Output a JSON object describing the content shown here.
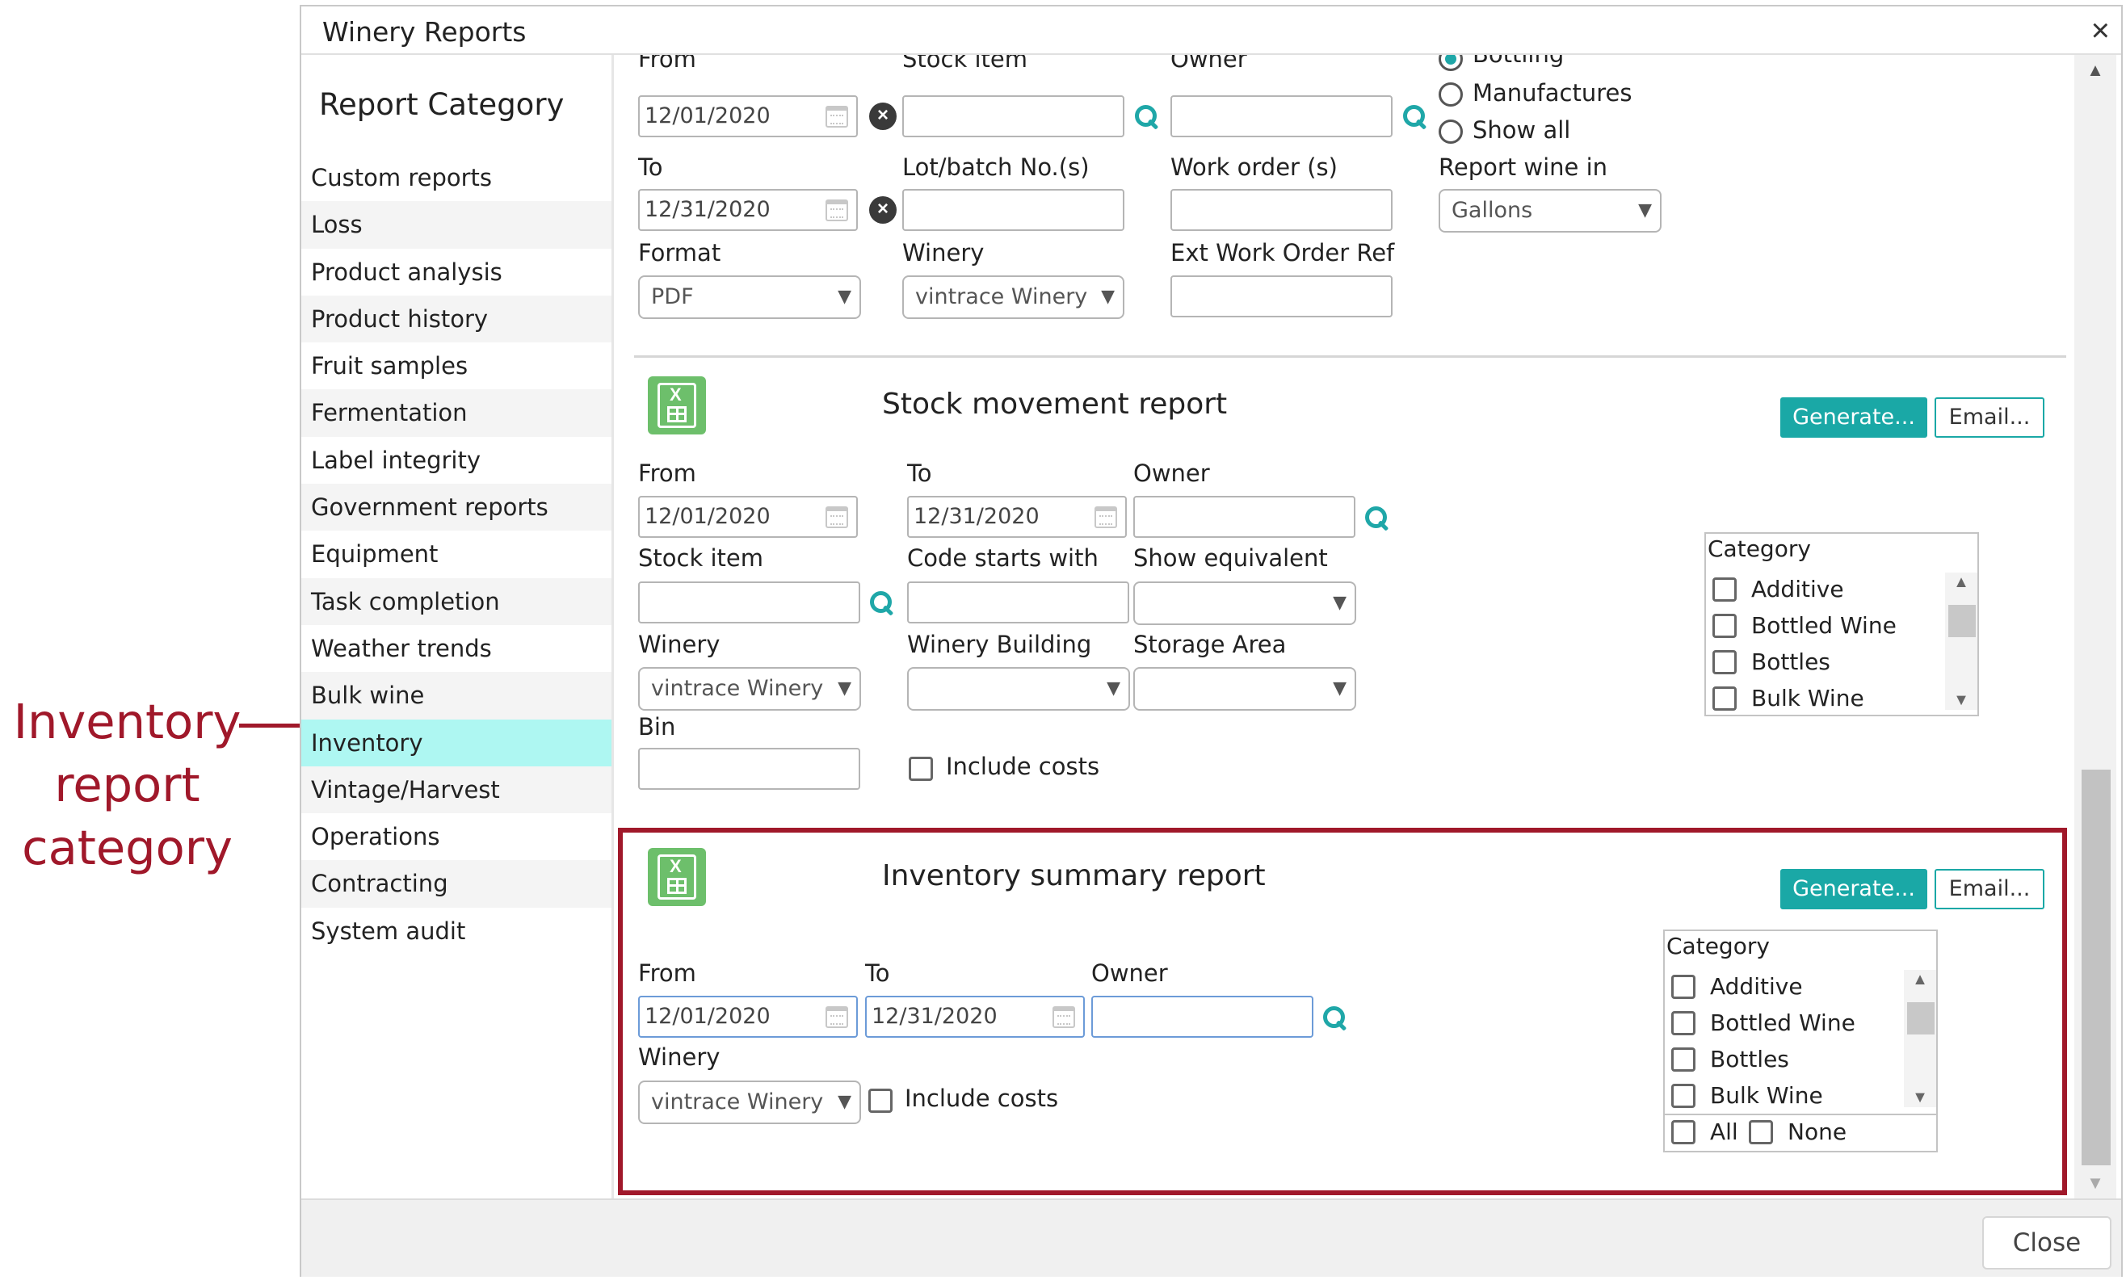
{
  "callout": {
    "line1": "Inventory",
    "line2": "report",
    "line3": "category"
  },
  "window": {
    "title": "Winery Reports",
    "close_icon": "×"
  },
  "sidebar": {
    "heading": "Report Category",
    "items": [
      {
        "label": "Custom reports"
      },
      {
        "label": "Loss"
      },
      {
        "label": "Product analysis"
      },
      {
        "label": "Product history"
      },
      {
        "label": "Fruit samples"
      },
      {
        "label": "Fermentation"
      },
      {
        "label": "Label integrity"
      },
      {
        "label": "Government reports"
      },
      {
        "label": "Equipment"
      },
      {
        "label": "Task completion"
      },
      {
        "label": "Weather trends"
      },
      {
        "label": "Bulk wine"
      },
      {
        "label": "Inventory"
      },
      {
        "label": "Vintage/Harvest"
      },
      {
        "label": "Operations"
      },
      {
        "label": "Contracting"
      },
      {
        "label": "System audit"
      }
    ],
    "active": "Inventory"
  },
  "top_report": {
    "from_label": "From",
    "from_value": "12/01/2020",
    "to_label": "To",
    "to_value": "12/31/2020",
    "format_label": "Format",
    "format_value": "PDF",
    "stock_item_label": "Stock item",
    "lot_label": "Lot/batch No.(s)",
    "winery_label": "Winery",
    "winery_value": "vintrace Winery",
    "owner_label": "Owner",
    "work_order_label": "Work order (s)",
    "ext_work_order_label": "Ext Work Order Ref",
    "radio_bottling": "Bottling",
    "radio_manufactures": "Manufactures",
    "radio_show_all": "Show all",
    "report_wine_in_label": "Report wine in",
    "report_wine_in_value": "Gallons"
  },
  "stock_movement": {
    "title": "Stock movement report",
    "generate_label": "Generate...",
    "email_label": "Email...",
    "from_label": "From",
    "from_value": "12/01/2020",
    "to_label": "To",
    "to_value": "12/31/2020",
    "owner_label": "Owner",
    "stock_item_label": "Stock item",
    "code_starts_label": "Code starts with",
    "show_equivalent_label": "Show equivalent",
    "winery_label": "Winery",
    "winery_value": "vintrace Winery",
    "winery_building_label": "Winery Building",
    "storage_area_label": "Storage Area",
    "bin_label": "Bin",
    "include_costs_label": "Include costs",
    "category_label": "Category",
    "categories": [
      "Additive",
      "Bottled Wine",
      "Bottles",
      "Bulk Wine"
    ]
  },
  "inventory_summary": {
    "title": "Inventory summary report",
    "generate_label": "Generate...",
    "email_label": "Email...",
    "from_label": "From",
    "from_value": "12/01/2020",
    "to_label": "To",
    "to_value": "12/31/2020",
    "owner_label": "Owner",
    "winery_label": "Winery",
    "winery_value": "vintrace Winery",
    "include_costs_label": "Include costs",
    "category_label": "Category",
    "categories": [
      "Additive",
      "Bottled Wine",
      "Bottles",
      "Bulk Wine"
    ],
    "all_label": "All",
    "none_label": "None"
  },
  "footer": {
    "close_label": "Close"
  },
  "colors": {
    "accent": "#1aa8a6",
    "highlight": "#a0182a",
    "active_item": "#aef7f2"
  },
  "icons": [
    "close-icon",
    "calendar-icon",
    "clear-icon",
    "search-icon",
    "spreadsheet-report-icon",
    "chevron-down-icon"
  ]
}
